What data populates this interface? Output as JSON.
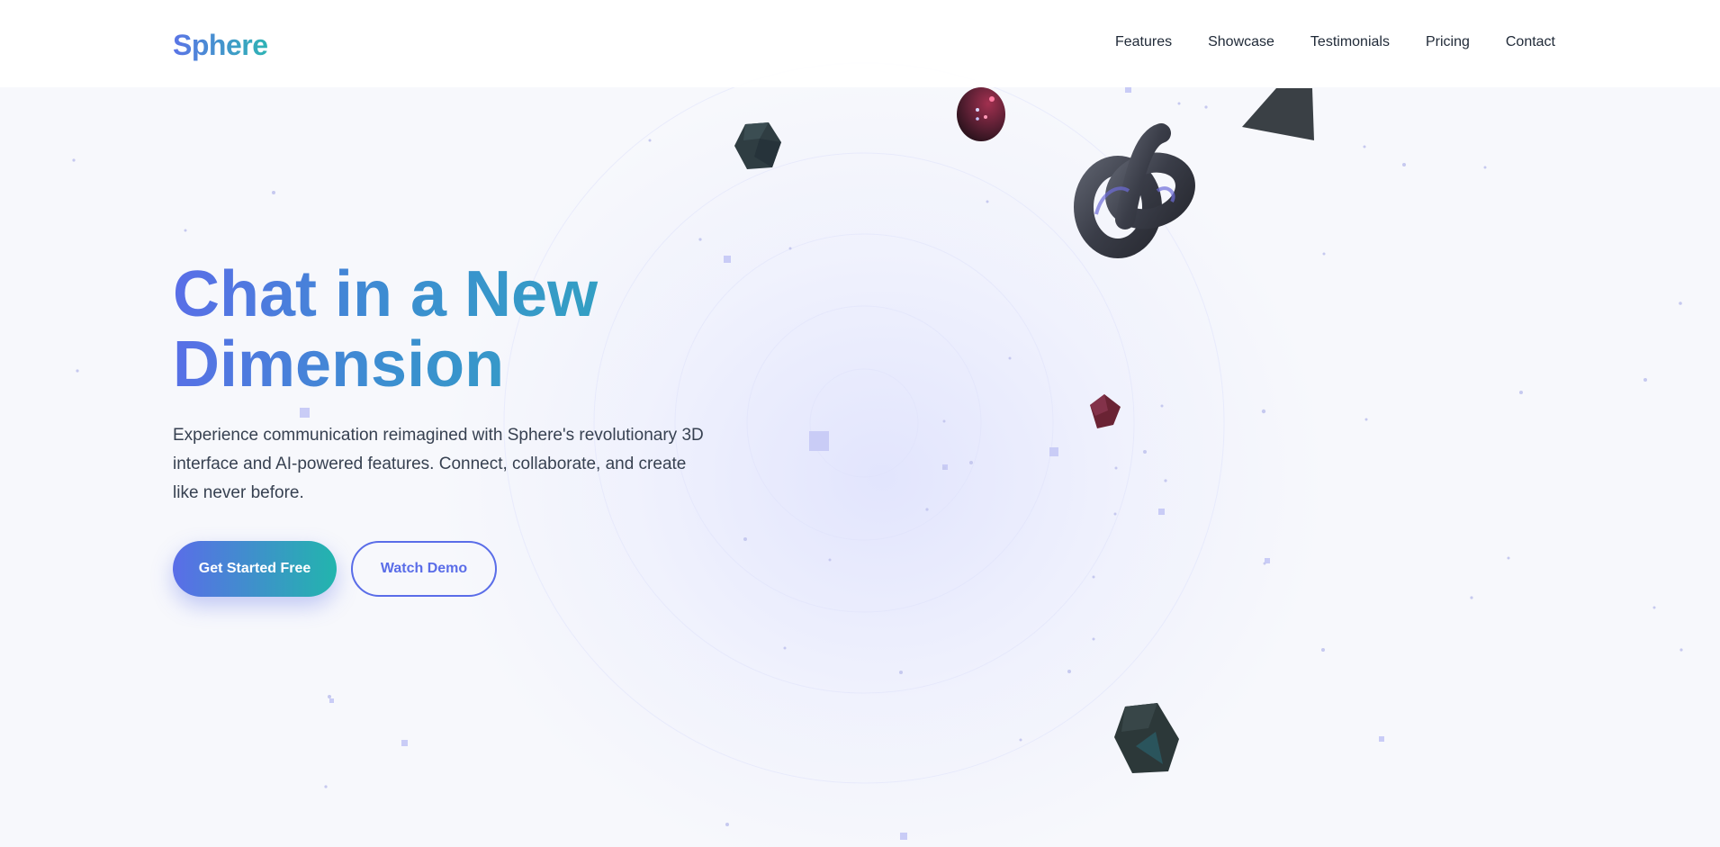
{
  "app": {
    "logo": "Sphere"
  },
  "nav": {
    "items": [
      {
        "label": "Features"
      },
      {
        "label": "Showcase"
      },
      {
        "label": "Testimonials"
      },
      {
        "label": "Pricing"
      },
      {
        "label": "Contact"
      }
    ]
  },
  "hero": {
    "title_line1": "Chat in a New",
    "title_line2": "Dimension",
    "description": "Experience communication reimagined with Sphere's revolutionary 3D interface and AI-powered features. Connect, collaborate, and create like never before.",
    "primary_cta": "Get Started Free",
    "secondary_cta": "Watch Demo"
  },
  "colors": {
    "brand_start": "#5a6de8",
    "brand_end": "#22b5ad",
    "background": "#f7f8fc",
    "text": "#1f2937"
  },
  "decor": {
    "shapes": [
      "torus-knot-icon",
      "sphere-icon",
      "pyramid-icon",
      "dodecahedron-icon",
      "cube-icon"
    ]
  }
}
